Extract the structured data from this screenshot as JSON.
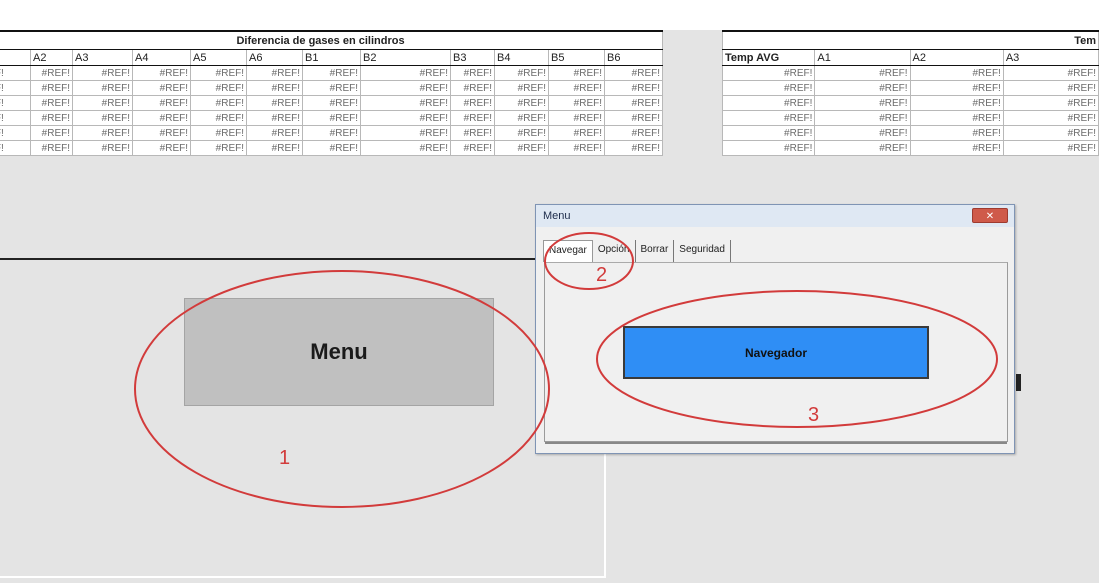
{
  "table1": {
    "title": "Diferencia de gases en cilindros",
    "headers": [
      "",
      "A2",
      "A3",
      "A4",
      "A5",
      "A6",
      "B1",
      "B2",
      "B3",
      "B4",
      "B5",
      "B6"
    ],
    "rows": [
      [
        "REF!",
        "#REF!",
        "#REF!",
        "#REF!",
        "#REF!",
        "#REF!",
        "#REF!",
        "#REF!",
        "#REF!",
        "#REF!",
        "#REF!",
        "#REF!"
      ],
      [
        "REF!",
        "#REF!",
        "#REF!",
        "#REF!",
        "#REF!",
        "#REF!",
        "#REF!",
        "#REF!",
        "#REF!",
        "#REF!",
        "#REF!",
        "#REF!"
      ],
      [
        "REF!",
        "#REF!",
        "#REF!",
        "#REF!",
        "#REF!",
        "#REF!",
        "#REF!",
        "#REF!",
        "#REF!",
        "#REF!",
        "#REF!",
        "#REF!"
      ],
      [
        "REF!",
        "#REF!",
        "#REF!",
        "#REF!",
        "#REF!",
        "#REF!",
        "#REF!",
        "#REF!",
        "#REF!",
        "#REF!",
        "#REF!",
        "#REF!"
      ],
      [
        "REF!",
        "#REF!",
        "#REF!",
        "#REF!",
        "#REF!",
        "#REF!",
        "#REF!",
        "#REF!",
        "#REF!",
        "#REF!",
        "#REF!",
        "#REF!"
      ],
      [
        "REF!",
        "#REF!",
        "#REF!",
        "#REF!",
        "#REF!",
        "#REF!",
        "#REF!",
        "#REF!",
        "#REF!",
        "#REF!",
        "#REF!",
        "#REF!"
      ]
    ]
  },
  "table2": {
    "title": "Tem",
    "headers": [
      "Temp AVG",
      "A1",
      "A2",
      "A3"
    ],
    "rows": [
      [
        "#REF!",
        "#REF!",
        "#REF!",
        "#REF!"
      ],
      [
        "#REF!",
        "#REF!",
        "#REF!",
        "#REF!"
      ],
      [
        "#REF!",
        "#REF!",
        "#REF!",
        "#REF!"
      ],
      [
        "#REF!",
        "#REF!",
        "#REF!",
        "#REF!"
      ],
      [
        "#REF!",
        "#REF!",
        "#REF!",
        "#REF!"
      ],
      [
        "#REF!",
        "#REF!",
        "#REF!",
        "#REF!"
      ]
    ]
  },
  "sheet_button": {
    "label": "Menu"
  },
  "dialog": {
    "title": "Menu",
    "close_label": "✕",
    "tabs": [
      "Navegar",
      "Opción",
      "Borrar",
      "Seguridad"
    ],
    "active_tab": "Navegar",
    "button_label": "Navegador"
  },
  "annotations": [
    "1",
    "2",
    "3"
  ],
  "colors": {
    "annotation": "#d23b3b",
    "nav_button": "#2f8ef5",
    "menu_button": "#c0c0c0"
  }
}
